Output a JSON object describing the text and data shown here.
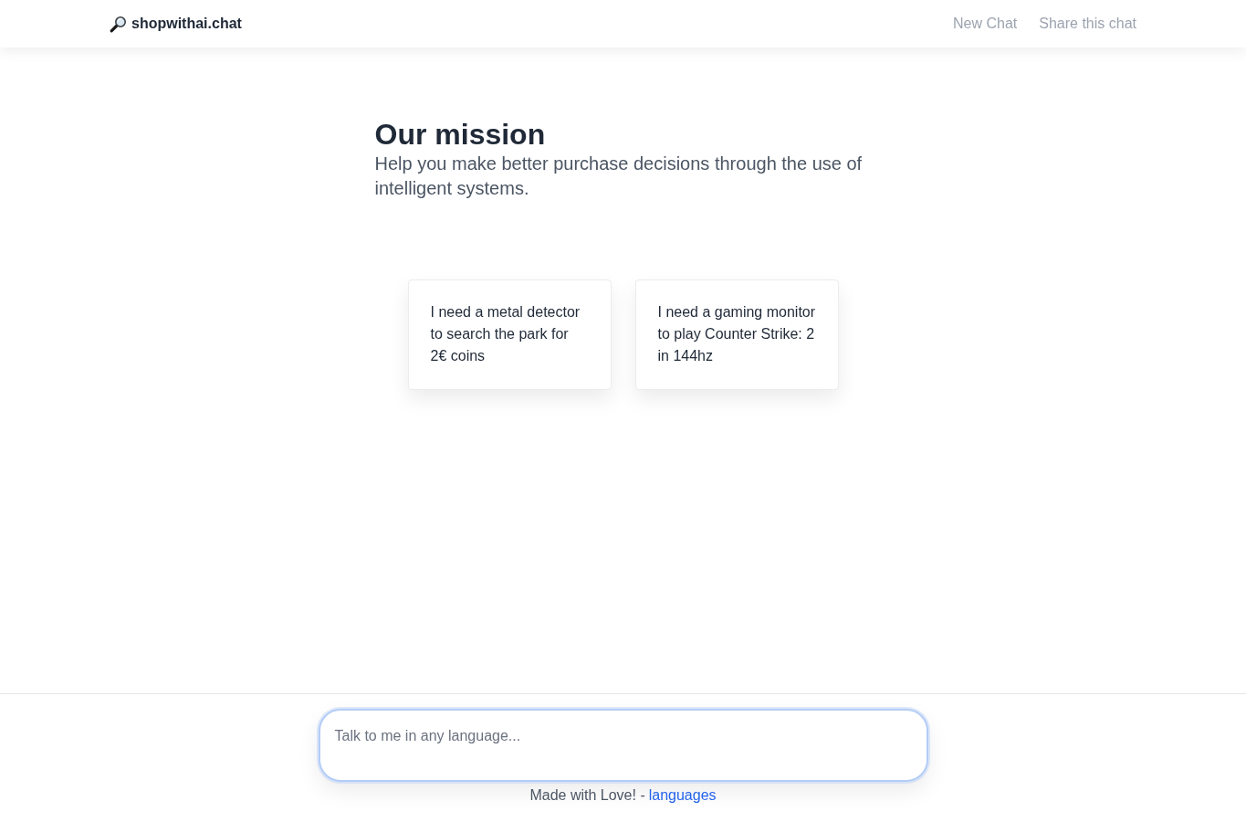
{
  "header": {
    "logo": "shopwithai.chat",
    "nav": [
      "New Chat",
      "Share this chat"
    ]
  },
  "mission": {
    "title": "Our mission",
    "subtitle": "Help you make better purchase decisions through the use of intelligent systems."
  },
  "suggestions": [
    "I need a metal detector to search the park for 2€ coins",
    "I need a gaming monitor to play Counter Strike: 2 in 144hz"
  ],
  "composer": {
    "placeholder": "Talk to me in any language..."
  },
  "footer": {
    "text": "Made with Love! -",
    "link": "languages"
  }
}
